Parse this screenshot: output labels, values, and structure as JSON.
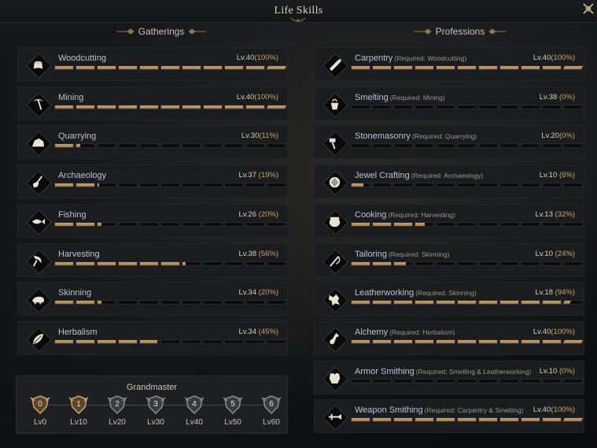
{
  "window": {
    "title": "Life Skills"
  },
  "headers": {
    "gatherings": "Gatherings",
    "professions": "Professions"
  },
  "colors": {
    "bar_fill": "#c9a676",
    "percent": "#c9a46a",
    "name": "#b9c2d6",
    "row_bg": "#1b1c1e"
  },
  "gatherings": [
    {
      "name": "Woodcutting",
      "req": "",
      "level": "Lv.40",
      "percent": "(100%)",
      "progress": 1.0,
      "icon": "stump-icon"
    },
    {
      "name": "Mining",
      "req": "",
      "level": "Lv.40",
      "percent": "(100%)",
      "progress": 1.0,
      "icon": "pickaxe-icon"
    },
    {
      "name": "Quarrying",
      "req": "",
      "level": "Lv.30",
      "percent": "(11%)",
      "progress": 0.11,
      "icon": "rock-icon"
    },
    {
      "name": "Archaeology",
      "req": "",
      "level": "Lv.37 ",
      "percent": "(19%)",
      "progress": 0.19,
      "icon": "shovel-icon"
    },
    {
      "name": "Fishing",
      "req": "",
      "level": "Lv.26 ",
      "percent": "(20%)",
      "progress": 0.2,
      "icon": "fish-icon"
    },
    {
      "name": "Harvesting",
      "req": "",
      "level": "Lv.38 ",
      "percent": "(56%)",
      "progress": 0.56,
      "icon": "sickle-icon"
    },
    {
      "name": "Skinning",
      "req": "",
      "level": "Lv.34 ",
      "percent": "(20%)",
      "progress": 0.2,
      "icon": "boar-icon"
    },
    {
      "name": "Herbalism",
      "req": "",
      "level": "Lv.34 ",
      "percent": "(45%)",
      "progress": 0.45,
      "icon": "leaf-icon"
    }
  ],
  "professions": [
    {
      "name": "Carpentry",
      "req": "(Required: Woodcutting)",
      "level": "Lv.40",
      "percent": "(100%)",
      "progress": 1.0,
      "icon": "saw-icon"
    },
    {
      "name": "Smelting",
      "req": "(Required: Mining)",
      "level": "Lv.38 ",
      "percent": "(0%)",
      "progress": 0.0,
      "icon": "crucible-icon"
    },
    {
      "name": "Stonemasonry",
      "req": "(Required: Quarrying)",
      "level": "Lv.20",
      "percent": "(0%)",
      "progress": 0.0,
      "icon": "hammer-icon"
    },
    {
      "name": "Jewel Crafting",
      "req": "(Required: Archaeology)",
      "level": "Lv.10 ",
      "percent": "(6%)",
      "progress": 0.06,
      "icon": "gem-icon"
    },
    {
      "name": "Cooking",
      "req": "(Required: Harvesting)",
      "level": "Lv.13 ",
      "percent": "(32%)",
      "progress": 0.32,
      "icon": "pot-icon"
    },
    {
      "name": "Tailoring",
      "req": "(Required: Skinning)",
      "level": "Lv.10 ",
      "percent": "(24%)",
      "progress": 0.24,
      "icon": "needle-icon"
    },
    {
      "name": "Leatherworking",
      "req": "(Required: Skinning)",
      "level": "Lv.18 ",
      "percent": "(94%)",
      "progress": 0.94,
      "icon": "hide-icon"
    },
    {
      "name": "Alchemy",
      "req": "(Required: Herbalism)",
      "level": "Lv.40",
      "percent": "(100%)",
      "progress": 1.0,
      "icon": "flask-icon"
    },
    {
      "name": "Armor Smithing",
      "req": "(Required: Smelting & Leatherworking)",
      "level": "Lv.10 ",
      "percent": "(0%)",
      "progress": 0.0,
      "icon": "armor-icon"
    },
    {
      "name": "Weapon Smithing",
      "req": "(Required: Carpentry & Smelting)",
      "level": "Lv.40",
      "percent": "(100%)",
      "progress": 1.0,
      "icon": "sword-icon"
    }
  ],
  "grandmaster": {
    "title": "Grandmaster",
    "tiers": [
      {
        "num": "0",
        "label": "Lv0",
        "achieved": true
      },
      {
        "num": "1",
        "label": "Lv10",
        "achieved": true
      },
      {
        "num": "2",
        "label": "Lv20",
        "achieved": false
      },
      {
        "num": "3",
        "label": "Lv30",
        "achieved": false
      },
      {
        "num": "4",
        "label": "Lv40",
        "achieved": false
      },
      {
        "num": "5",
        "label": "Lv50",
        "achieved": false
      },
      {
        "num": "6",
        "label": "Lv60",
        "achieved": false
      }
    ]
  }
}
